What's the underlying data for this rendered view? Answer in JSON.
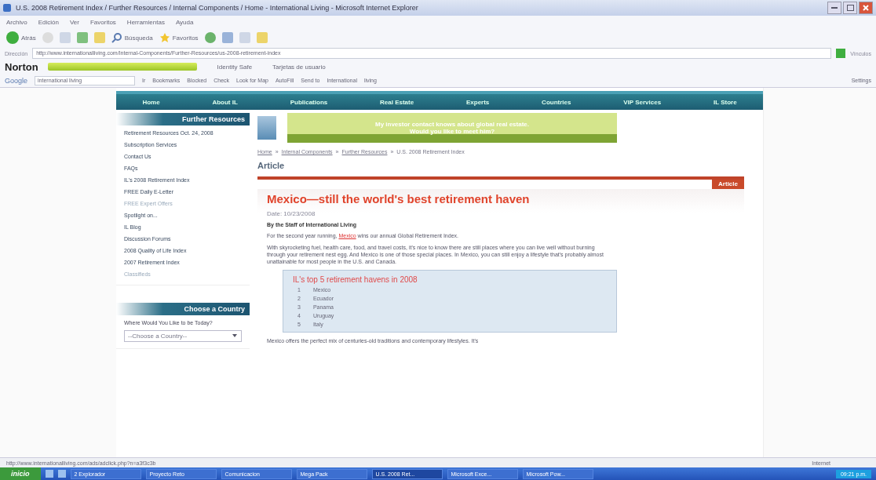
{
  "window": {
    "title": "U.S. 2008 Retirement Index / Further Resources / Internal Components / Home - International Living - Microsoft Internet Explorer"
  },
  "menu": [
    "Archivo",
    "Edición",
    "Ver",
    "Favoritos",
    "Herramientas",
    "Ayuda"
  ],
  "toolbar": {
    "back": "Atrás",
    "search": "Búsqueda",
    "favorites": "Favoritos"
  },
  "address": {
    "label": "Dirección",
    "value": "http://www.internationalliving.com/Internal-Components/Further-Resources/us-2008-retirement-index",
    "go": "Vínculos"
  },
  "norton": {
    "brand": "Norton",
    "items": [
      "Identity Safe",
      "Tarjetas de usuario"
    ]
  },
  "google": {
    "brand": "Google",
    "query": "international living",
    "go": "Ir",
    "items": [
      "Bookmarks",
      "Blocked",
      "Check",
      "Look for Map",
      "AutoFill",
      "Send to",
      "International",
      "living"
    ],
    "settings": "Settings"
  },
  "nav": [
    {
      "label": "Home"
    },
    {
      "label": "About IL"
    },
    {
      "label": "Publications"
    },
    {
      "label": "Real Estate"
    },
    {
      "label": "Experts"
    },
    {
      "label": "Countries"
    },
    {
      "label": "VIP Services"
    },
    {
      "label": "IL Store"
    }
  ],
  "sidebar": {
    "title": "Further Resources",
    "items": [
      {
        "label": "Retirement Resources Oct. 24, 2008",
        "disabled": false
      },
      {
        "label": "Subscription Services",
        "disabled": false
      },
      {
        "label": "Contact Us",
        "disabled": false
      },
      {
        "label": "FAQs",
        "disabled": false
      },
      {
        "label": "IL's 2008 Retirement Index",
        "disabled": false
      },
      {
        "label": "FREE Daily E-Letter",
        "disabled": false
      },
      {
        "label": "FREE Expert Offers",
        "disabled": true
      },
      {
        "label": "Spotlight on...",
        "disabled": false
      },
      {
        "label": "IL Blog",
        "disabled": false
      },
      {
        "label": "Discussion Forums",
        "disabled": false
      },
      {
        "label": "2008 Quality of Life Index",
        "disabled": false
      },
      {
        "label": "2007 Retirement Index",
        "disabled": false
      },
      {
        "label": "Classifieds",
        "disabled": true
      }
    ]
  },
  "country_box": {
    "title": "Choose a Country",
    "question": "Where Would You Like to be Today?",
    "select": "--Choose a Country--"
  },
  "banner": {
    "line1": "My investor contact knows about global real estate.",
    "line2": "Would you like to meet him?"
  },
  "breadcrumb_separator": "»",
  "breadcrumb": [
    "Home",
    "Internal Components",
    "Further Resources",
    "U.S. 2008 Retirement Index"
  ],
  "heading": "Article",
  "article": {
    "tag": "Article",
    "title": "Mexico—still the world's best retirement haven",
    "date": "Date: 10/23/2008",
    "byline": "By the Staff of International Living",
    "lead_before": "For the second year running, ",
    "lead_link": "Mexico",
    "lead_after": " wins our annual Global Retirement Index.",
    "paragraph": "With skyrocketing fuel, health care, food, and travel costs, it's nice to know there are still places where you can live well without burning through your retirement nest egg. And Mexico is one of those special places. In Mexico, you can still enjoy a lifestyle that's probably almost unattainable for most people in the U.S. and Canada.",
    "box_title": "IL's top 5 retirement havens in 2008",
    "havens": [
      {
        "n": "1",
        "name": "Mexico"
      },
      {
        "n": "2",
        "name": "Ecuador"
      },
      {
        "n": "3",
        "name": "Panama"
      },
      {
        "n": "4",
        "name": "Uruguay"
      },
      {
        "n": "5",
        "name": "Italy"
      }
    ],
    "after": "Mexico offers the perfect mix of centuries-old traditions and contemporary lifestyles. It's"
  },
  "status_bar": {
    "url": "http://www.internationalliving.com/ads/adclick.php?n=a3f3c3b",
    "zone": "Internet"
  },
  "taskbar": {
    "start": "inicio",
    "tasks": [
      {
        "label": "2 Explorador",
        "selected": false
      },
      {
        "label": "Proyecto Reto",
        "selected": false
      },
      {
        "label": "Comunicacion",
        "selected": false
      },
      {
        "label": "Mega Pack",
        "selected": false
      },
      {
        "label": "U.S. 2008 Ret...",
        "selected": true
      },
      {
        "label": "Microsoft Exce...",
        "selected": false
      },
      {
        "label": "Microsoft Pow...",
        "selected": false
      }
    ],
    "clock": "09:21 p.m."
  }
}
